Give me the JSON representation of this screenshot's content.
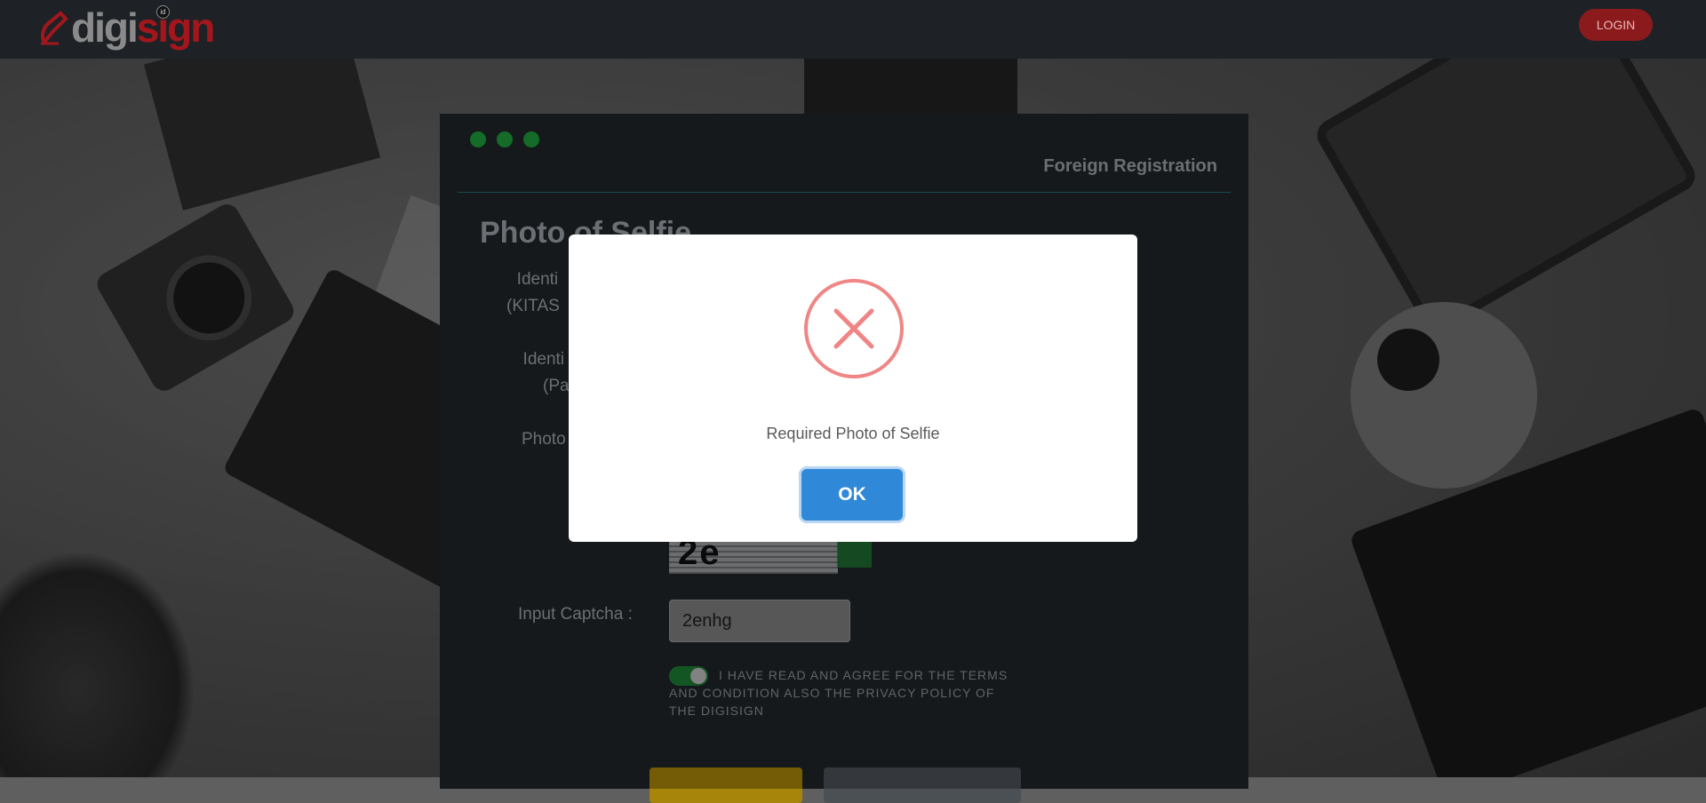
{
  "brand": {
    "digi": "digi",
    "sign": "sign",
    "superscript": "id"
  },
  "navbar": {
    "login_label": "LOGIN"
  },
  "panel": {
    "title": "Foreign Registration",
    "section_heading": "Photo of Selfie",
    "fields": [
      {
        "label_line1": "Identi",
        "label_line2": "(KITAS"
      },
      {
        "label_line1": "Identi",
        "label_line2": "(Pa"
      },
      {
        "label_line1": "Photo",
        "label_line2": ""
      }
    ],
    "captcha_image_text": "2e",
    "captcha_label": "Input Captcha :",
    "captcha_value": "2enhg",
    "terms_text": "I HAVE READ AND AGREE FOR THE TERMS AND CONDITION ALSO THE PRIVACY POLICY OF THE DIGISIGN"
  },
  "modal": {
    "icon": "error-x-icon",
    "message": "Required Photo of Selfie",
    "ok_label": "OK"
  },
  "colors": {
    "brand_red": "#a3171c",
    "error_red": "#f08585",
    "ok_blue": "#3088d8",
    "accent_green": "#1d9b3a"
  }
}
